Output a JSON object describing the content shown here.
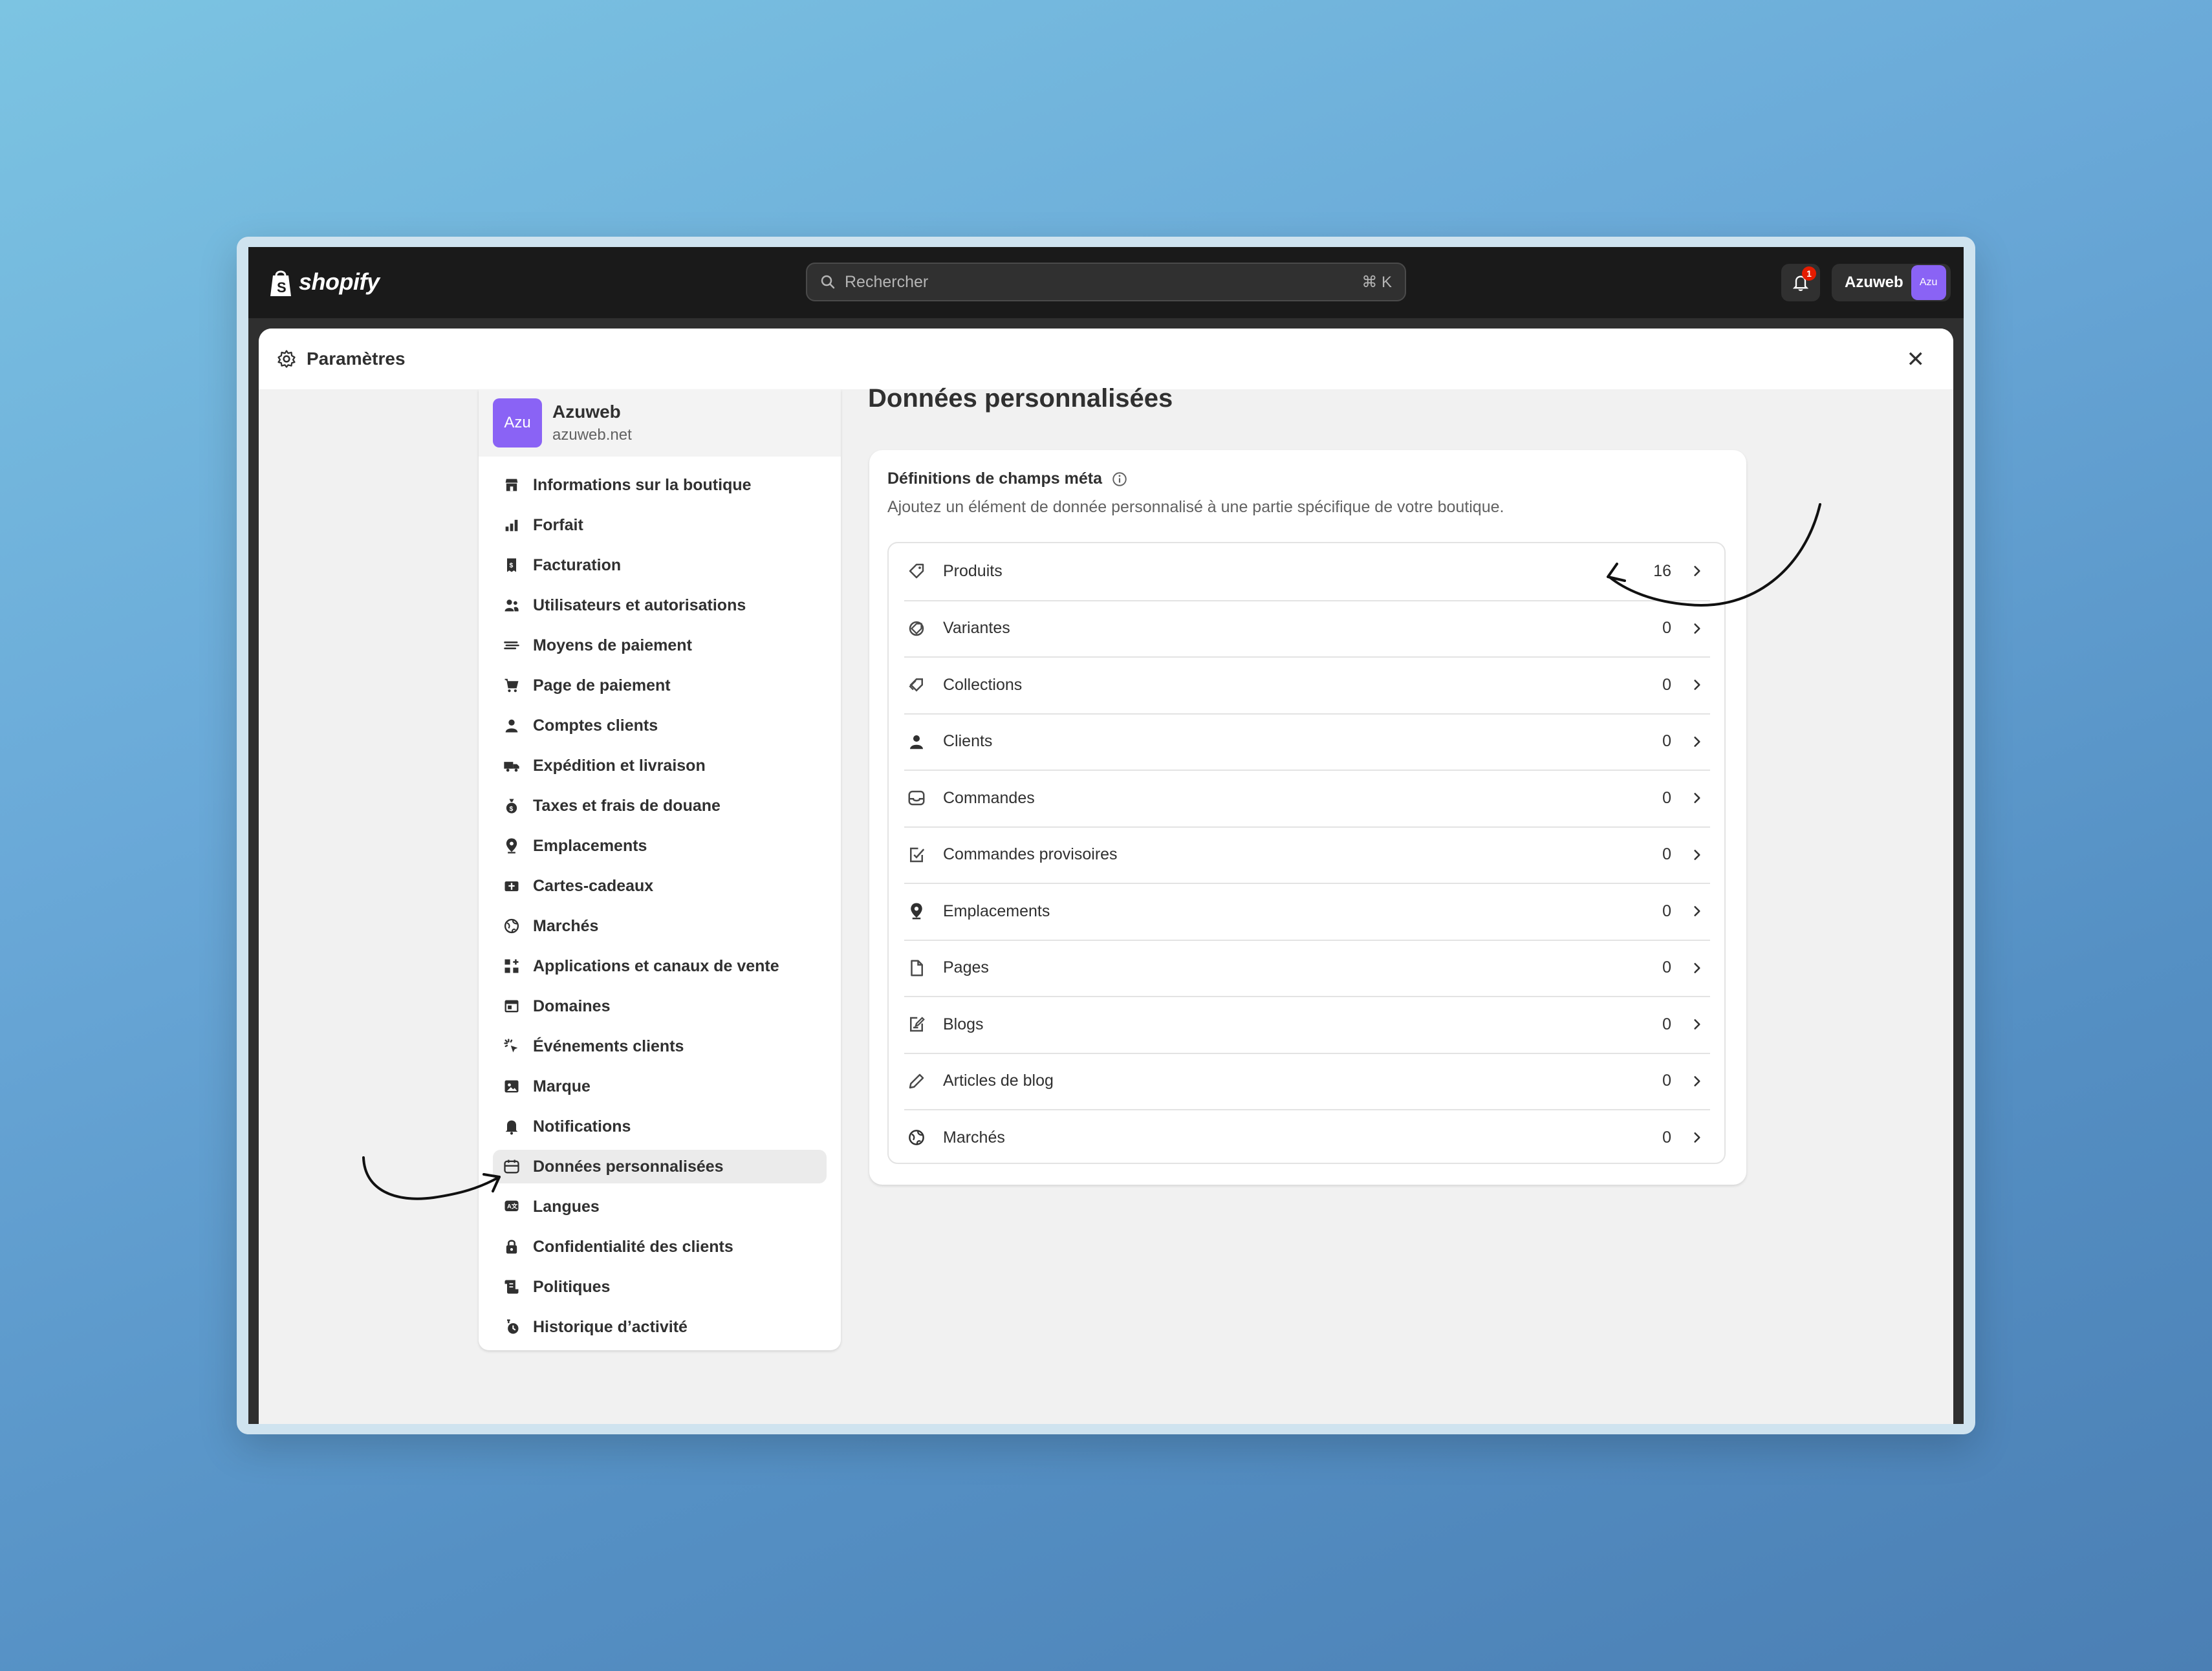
{
  "brand": {
    "name": "shopify"
  },
  "search": {
    "placeholder": "Rechercher",
    "shortcut": "⌘ K"
  },
  "notifications": {
    "count": "1"
  },
  "account": {
    "name": "Azuweb",
    "avatar": "Azu"
  },
  "modal": {
    "title": "Paramètres"
  },
  "store": {
    "avatar": "Azu",
    "name": "Azuweb",
    "domain": "azuweb.net"
  },
  "sidebar": {
    "items": [
      {
        "label": "Informations sur la boutique",
        "icon": "store-icon"
      },
      {
        "label": "Forfait",
        "icon": "chart-icon"
      },
      {
        "label": "Facturation",
        "icon": "receipt-icon"
      },
      {
        "label": "Utilisateurs et autorisations",
        "icon": "users-icon"
      },
      {
        "label": "Moyens de paiement",
        "icon": "payment-icon"
      },
      {
        "label": "Page de paiement",
        "icon": "cart-icon"
      },
      {
        "label": "Comptes clients",
        "icon": "person-icon"
      },
      {
        "label": "Expédition et livraison",
        "icon": "truck-icon"
      },
      {
        "label": "Taxes et frais de douane",
        "icon": "moneybag-icon"
      },
      {
        "label": "Emplacements",
        "icon": "location-icon"
      },
      {
        "label": "Cartes-cadeaux",
        "icon": "giftcard-icon"
      },
      {
        "label": "Marchés",
        "icon": "globe-icon"
      },
      {
        "label": "Applications et canaux de vente",
        "icon": "apps-icon"
      },
      {
        "label": "Domaines",
        "icon": "domain-icon"
      },
      {
        "label": "Événements clients",
        "icon": "cursor-icon"
      },
      {
        "label": "Marque",
        "icon": "brand-icon"
      },
      {
        "label": "Notifications",
        "icon": "bell-icon"
      },
      {
        "label": "Données personnalisées",
        "icon": "database-icon",
        "active": true
      },
      {
        "label": "Langues",
        "icon": "language-icon"
      },
      {
        "label": "Confidentialité des clients",
        "icon": "lock-icon"
      },
      {
        "label": "Politiques",
        "icon": "policy-icon"
      },
      {
        "label": "Historique d’activité",
        "icon": "history-icon"
      }
    ]
  },
  "main": {
    "title": "Données personnalisées",
    "card": {
      "heading": "Définitions de champs méta",
      "description": "Ajoutez un élément de donnée personnalisé à une partie spécifique de votre boutique.",
      "rows": [
        {
          "label": "Produits",
          "count": "16",
          "icon": "tag-icon"
        },
        {
          "label": "Variantes",
          "count": "0",
          "icon": "variant-icon"
        },
        {
          "label": "Collections",
          "count": "0",
          "icon": "collection-icon"
        },
        {
          "label": "Clients",
          "count": "0",
          "icon": "person-icon"
        },
        {
          "label": "Commandes",
          "count": "0",
          "icon": "inbox-icon"
        },
        {
          "label": "Commandes provisoires",
          "count": "0",
          "icon": "draft-order-icon"
        },
        {
          "label": "Emplacements",
          "count": "0",
          "icon": "location-icon"
        },
        {
          "label": "Pages",
          "count": "0",
          "icon": "page-icon"
        },
        {
          "label": "Blogs",
          "count": "0",
          "icon": "blog-icon"
        },
        {
          "label": "Articles de blog",
          "count": "0",
          "icon": "pen-icon"
        },
        {
          "label": "Marchés",
          "count": "0",
          "icon": "globe-icon"
        }
      ]
    }
  },
  "colors": {
    "accent": "#8a63f5",
    "topbar": "#1a1a1a",
    "badge": "#e51c00"
  }
}
